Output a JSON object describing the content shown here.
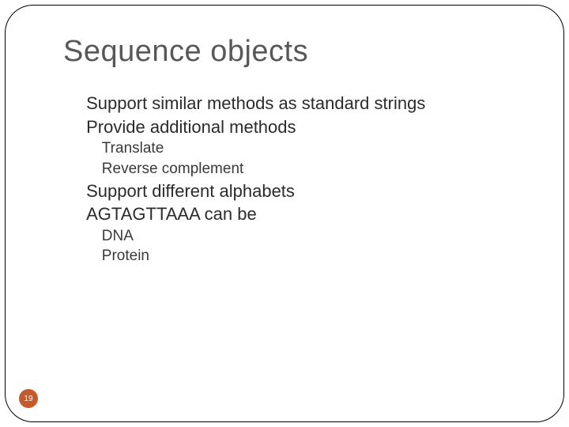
{
  "slide": {
    "title": "Sequence objects",
    "page_number": "19",
    "bullets": {
      "b1": "Support similar methods as standard strings",
      "b2": "Provide additional methods",
      "b2a": "Translate",
      "b2b": "Reverse complement",
      "b3": "Support different alphabets",
      "b4": "AGTAGTTAAA can be",
      "b4a": "DNA",
      "b4b": "Protein"
    }
  }
}
